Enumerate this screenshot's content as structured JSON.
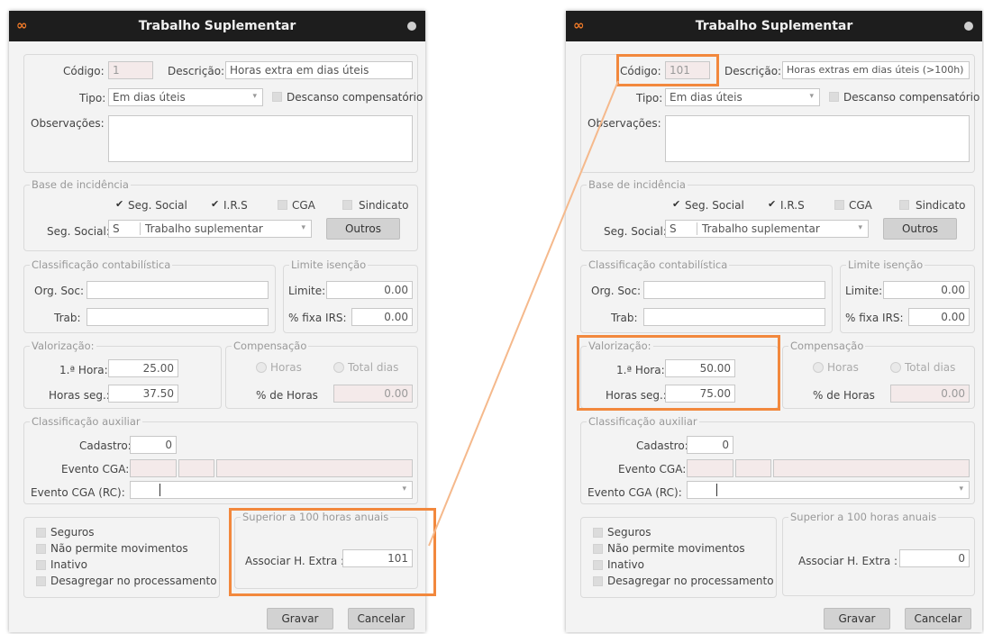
{
  "dialog": {
    "title": "Trabalho Suplementar",
    "labels": {
      "codigo": "Código:",
      "descricao": "Descrição:",
      "tipo": "Tipo:",
      "descanso": "Descanso compensatório",
      "observacoes": "Observações:",
      "base_incidencia": "Base de incidência",
      "seg_social_cb": "Seg. Social",
      "irs_cb": "I.R.S",
      "cga_cb": "CGA",
      "sindicato_cb": "Sindicato",
      "seg_social": "Seg. Social:",
      "outros": "Outros",
      "classif_contab": "Classificação contabilística",
      "org_soc": "Org. Soc:",
      "trab": "Trab:",
      "limite_isencao": "Limite isenção",
      "limite": "Limite:",
      "fixa_irs": "% fixa IRS:",
      "valorizacao": "Valorização:",
      "primeira_hora": "1.ª Hora:",
      "horas_seg": "Horas seg.:",
      "compensacao": "Compensação",
      "horas_radio": "Horas",
      "total_dias_radio": "Total dias",
      "pct_horas": "% de Horas",
      "classif_aux": "Classificação auxiliar",
      "cadastro": "Cadastro:",
      "evento_cga": "Evento CGA:",
      "evento_cga_rc": "Evento CGA (RC):",
      "seguros": "Seguros",
      "nao_permite": "Não permite movimentos",
      "inativo": "Inativo",
      "desagregar": "Desagregar no processamento",
      "superior_100": "Superior a 100 horas anuais",
      "associar": "Associar H. Extra :",
      "gravar": "Gravar",
      "cancelar": "Cancelar"
    }
  },
  "left": {
    "codigo": "1",
    "descricao": "Horas extra em dias úteis",
    "tipo": "Em dias úteis",
    "observacoes": "",
    "seg_social_code": "S",
    "seg_social_desc": "Trabalho suplementar",
    "org_soc": "",
    "trab": "",
    "limite": "0.00",
    "fixa_irs": "0.00",
    "primeira_hora": "25.00",
    "horas_seg": "37.50",
    "pct_horas": "0.00",
    "cadastro": "0",
    "evento_cga_rc": "",
    "associar": "101",
    "seg_social_checked": true,
    "irs_checked": true
  },
  "right": {
    "codigo": "101",
    "descricao": "Horas extras em dias úteis (>100h)",
    "tipo": "Em dias úteis",
    "observacoes": "",
    "seg_social_code": "S",
    "seg_social_desc": "Trabalho suplementar",
    "org_soc": "",
    "trab": "",
    "limite": "0.00",
    "fixa_irs": "0.00",
    "primeira_hora": "50.00",
    "horas_seg": "75.00",
    "pct_horas": "0.00",
    "cadastro": "0",
    "evento_cga_rc": "",
    "associar": "0",
    "seg_social_checked": true,
    "irs_checked": true
  },
  "colors": {
    "highlight": "#f2883d",
    "titlebar": "#1d1d1d",
    "logo": "#f07a28"
  },
  "icons": [
    "app-logo-icon",
    "close-icon",
    "chevron-down-icon",
    "checkmark-icon"
  ]
}
